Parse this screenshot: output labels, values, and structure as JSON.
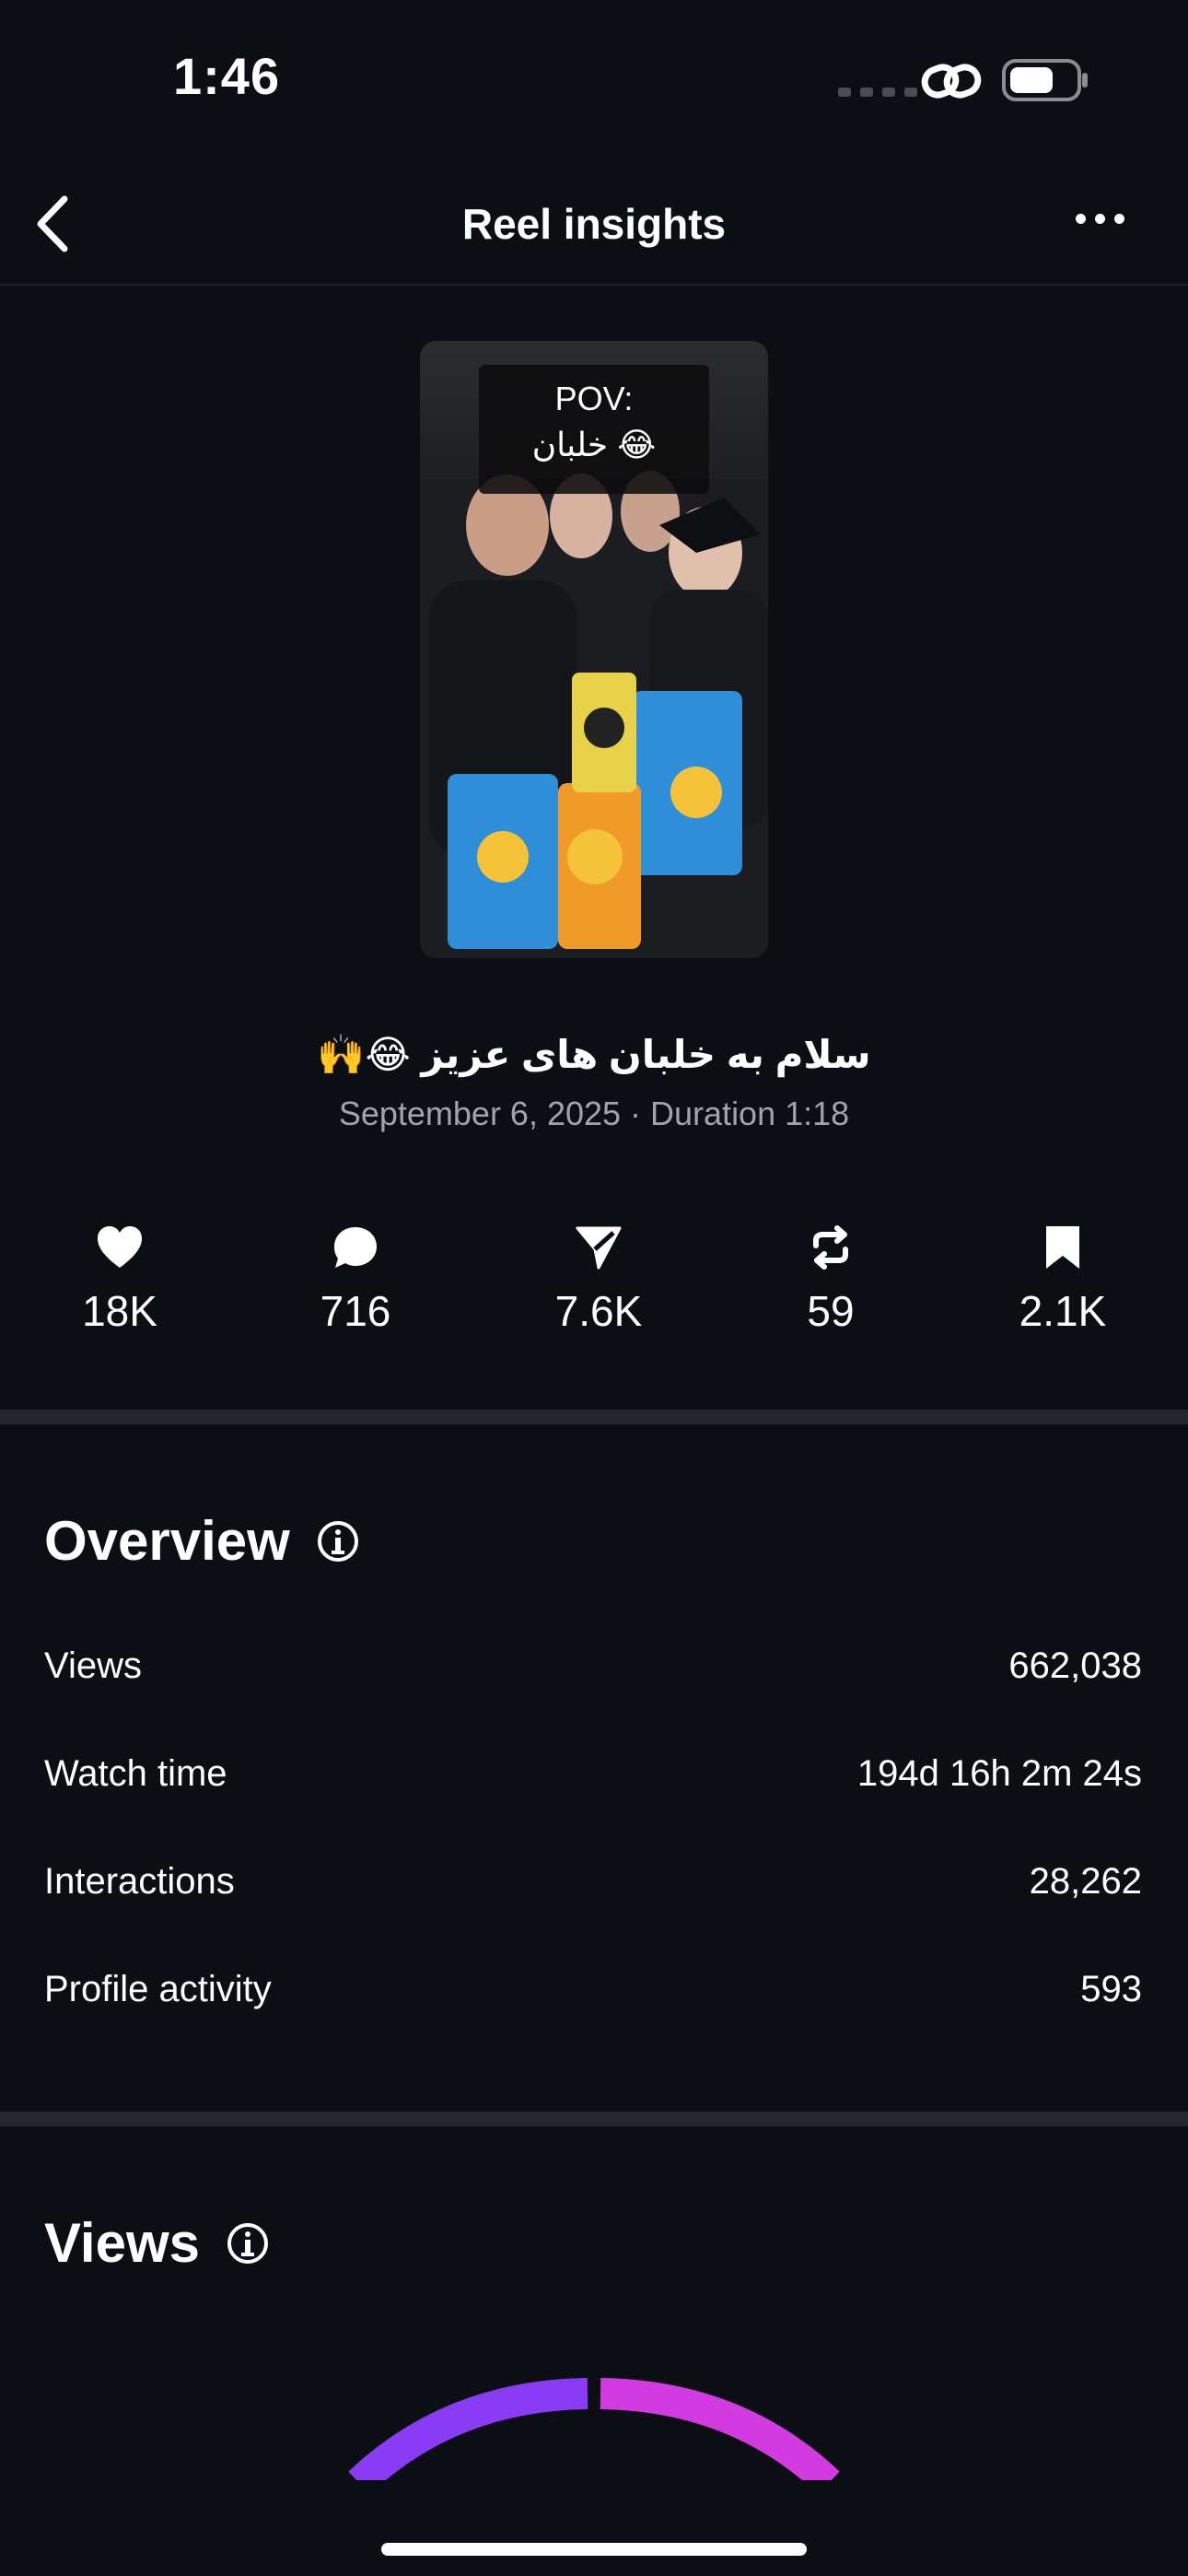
{
  "status_bar": {
    "time": "1:46",
    "icons": [
      "cellular-signal-icon",
      "link-icon",
      "battery-icon"
    ]
  },
  "header": {
    "title": "Reel insights",
    "back_icon": "chevron-left-icon",
    "more_icon": "ellipsis-icon"
  },
  "reel": {
    "thumbnail_text_line1": "POV:",
    "thumbnail_text_line2": "خلبان 😂",
    "caption": "سلام به خلبان های عزیز 😂🙌",
    "meta": "September 6, 2025 · Duration 1:18"
  },
  "stats": [
    {
      "icon": "heart-icon",
      "value": "18K"
    },
    {
      "icon": "comment-icon",
      "value": "716"
    },
    {
      "icon": "send-icon",
      "value": "7.6K"
    },
    {
      "icon": "repost-icon",
      "value": "59"
    },
    {
      "icon": "bookmark-icon",
      "value": "2.1K"
    }
  ],
  "overview": {
    "title": "Overview",
    "rows": [
      {
        "label": "Views",
        "value": "662,038"
      },
      {
        "label": "Watch time",
        "value": "194d 16h 2m 24s"
      },
      {
        "label": "Interactions",
        "value": "28,262"
      },
      {
        "label": "Profile activity",
        "value": "593"
      }
    ]
  },
  "views_section": {
    "title": "Views",
    "chart_colors": {
      "segment_1": "#8a3cf5",
      "segment_2": "#d23be0"
    }
  },
  "colors": {
    "background": "#0b0e13",
    "divider": "#22262d",
    "muted_text": "#a0a4ab"
  }
}
